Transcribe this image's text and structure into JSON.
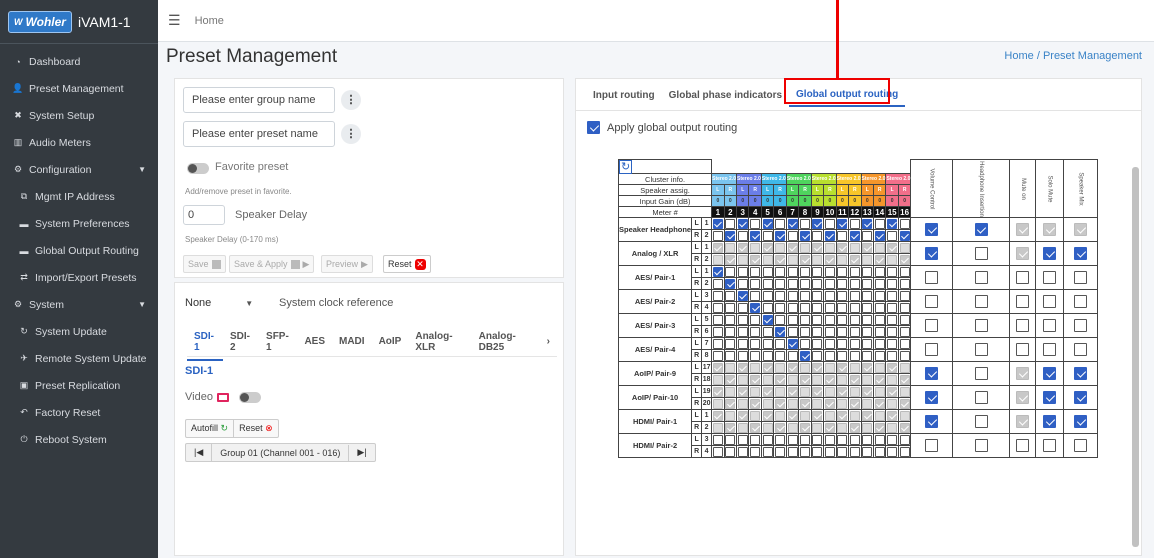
{
  "app": {
    "brand_logo": "Wohler",
    "brand_name": "iVAM1-1"
  },
  "sidebar": {
    "items": [
      {
        "label": "Dashboard",
        "icon": "tachometer-icon",
        "type": "item"
      },
      {
        "label": "Preset Management",
        "icon": "users-icon",
        "type": "item"
      },
      {
        "label": "System Setup",
        "icon": "tools-icon",
        "type": "item"
      },
      {
        "label": "Audio Meters",
        "icon": "bar-chart-icon",
        "type": "item"
      },
      {
        "label": "Configuration",
        "icon": "gear-icon",
        "type": "group"
      },
      {
        "label": "Mgmt IP Address",
        "icon": "network-icon",
        "type": "sub"
      },
      {
        "label": "System Preferences",
        "icon": "hdd-icon",
        "type": "sub"
      },
      {
        "label": "Global Output Routing",
        "icon": "hdd-icon",
        "type": "sub"
      },
      {
        "label": "Import/Export Presets",
        "icon": "exchange-icon",
        "type": "sub"
      },
      {
        "label": "System",
        "icon": "gears-icon",
        "type": "group"
      },
      {
        "label": "System Update",
        "icon": "sync-icon",
        "type": "sub"
      },
      {
        "label": "Remote System Update",
        "icon": "satellite-icon",
        "type": "sub"
      },
      {
        "label": "Preset Replication",
        "icon": "copy-icon",
        "type": "sub"
      },
      {
        "label": "Factory Reset",
        "icon": "undo-icon",
        "type": "sub"
      },
      {
        "label": "Reboot System",
        "icon": "power-icon",
        "type": "sub"
      }
    ]
  },
  "topbar": {
    "home": "Home"
  },
  "page": {
    "title": "Preset Management",
    "breadcrumb_link": "Home",
    "breadcrumb_current": "Preset Management"
  },
  "preset": {
    "group_placeholder": "Please enter group name",
    "preset_placeholder": "Please enter preset name",
    "favorite_label": "Favorite preset",
    "favorite_hint": "Add/remove preset in favorite.",
    "delay_value": "0",
    "delay_label": "Speaker Delay",
    "delay_hint": "Speaker Delay (0-170 ms)",
    "save": "Save",
    "save_apply": "Save & Apply",
    "preview": "Preview",
    "reset": "Reset"
  },
  "clock": {
    "value": "None",
    "label": "System clock reference"
  },
  "source_tabs": [
    "SDI-1",
    "SDI-2",
    "SFP-1",
    "AES",
    "MADI",
    "AoIP",
    "Analog-XLR",
    "Analog-DB25"
  ],
  "sdi": {
    "heading": "SDI-1",
    "video_label": "Video",
    "autofill": "Autofill",
    "reset": "Reset",
    "group_label": "Group 01 (Channel 001 - 016)"
  },
  "right_tabs": [
    "Input routing",
    "Global phase indicators",
    "Global output routing"
  ],
  "apply_label": "Apply global output routing",
  "matrix": {
    "row_labels": [
      "Cluster info.",
      "Speaker assig.",
      "Input Gain (dB)",
      "Meter #"
    ],
    "cluster_text": "Stereo 2.0",
    "cluster_colors": [
      "#7ac4ee",
      "#3a49c9",
      "#6b7ee8",
      "#3fb8e8",
      "#22c7a3",
      "#4fd45e",
      "#b8df2f",
      "#f2e320",
      "#f7c62a",
      "#f5962b",
      "#f07a5c",
      "#f26f8a"
    ],
    "speaker": [
      "L",
      "R",
      "L",
      "R",
      "L",
      "R",
      "L",
      "R",
      "L",
      "R",
      "L",
      "R",
      "L",
      "R",
      "L",
      "R"
    ],
    "gain": "0",
    "meters": [
      "1",
      "2",
      "3",
      "4",
      "5",
      "6",
      "7",
      "8",
      "9",
      "10",
      "11",
      "12",
      "13",
      "14",
      "15",
      "16"
    ],
    "control_headers": [
      "Volume Control",
      "Headphone Insertion",
      "Mute on",
      "Solo Mute",
      "Speaker Mix"
    ],
    "groups": [
      {
        "name": "Speaker Headphone",
        "rows": [
          [
            "L",
            "1"
          ],
          [
            "R",
            "2"
          ]
        ]
      },
      {
        "name": "Analog / XLR",
        "rows": [
          [
            "L",
            "1"
          ],
          [
            "R",
            "2"
          ]
        ]
      },
      {
        "name": "AES/ Pair-1",
        "rows": [
          [
            "L",
            "1"
          ],
          [
            "R",
            "2"
          ]
        ]
      },
      {
        "name": "AES/ Pair-2",
        "rows": [
          [
            "L",
            "3"
          ],
          [
            "R",
            "4"
          ]
        ]
      },
      {
        "name": "AES/ Pair-3",
        "rows": [
          [
            "L",
            "5"
          ],
          [
            "R",
            "6"
          ]
        ]
      },
      {
        "name": "AES/ Pair-4",
        "rows": [
          [
            "L",
            "7"
          ],
          [
            "R",
            "8"
          ]
        ]
      },
      {
        "name": "AoIP/ Pair-9",
        "rows": [
          [
            "L",
            "17"
          ],
          [
            "R",
            "18"
          ]
        ]
      },
      {
        "name": "AoIP/ Pair-10",
        "rows": [
          [
            "L",
            "19"
          ],
          [
            "R",
            "20"
          ]
        ]
      },
      {
        "name": "HDMI/ Pair-1",
        "rows": [
          [
            "L",
            "1"
          ],
          [
            "R",
            "2"
          ]
        ]
      },
      {
        "name": "HDMI/ Pair-2",
        "rows": [
          [
            "L",
            "3"
          ],
          [
            "R",
            "4"
          ]
        ]
      }
    ]
  },
  "colors": {
    "accent": "#2b63c2",
    "sidebar": "#343a40",
    "danger": "#e00000"
  }
}
